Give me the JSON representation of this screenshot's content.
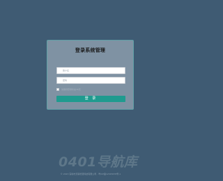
{
  "login": {
    "title": "登录系统管理",
    "username_placeholder": "账户名",
    "password_placeholder": "密码",
    "remember_label": "请保持登录状态30天",
    "submit_label": "登 录"
  },
  "watermark": "0401导航库",
  "footer": "© 2023 深圳市天联智慧科技有限公司 · 粤ICP备12345678号-1",
  "colors": {
    "background": "#3f5b73",
    "panel": "#7f92a3",
    "panel_border": "#5fa0a6",
    "accent": "#1f9b8f"
  }
}
